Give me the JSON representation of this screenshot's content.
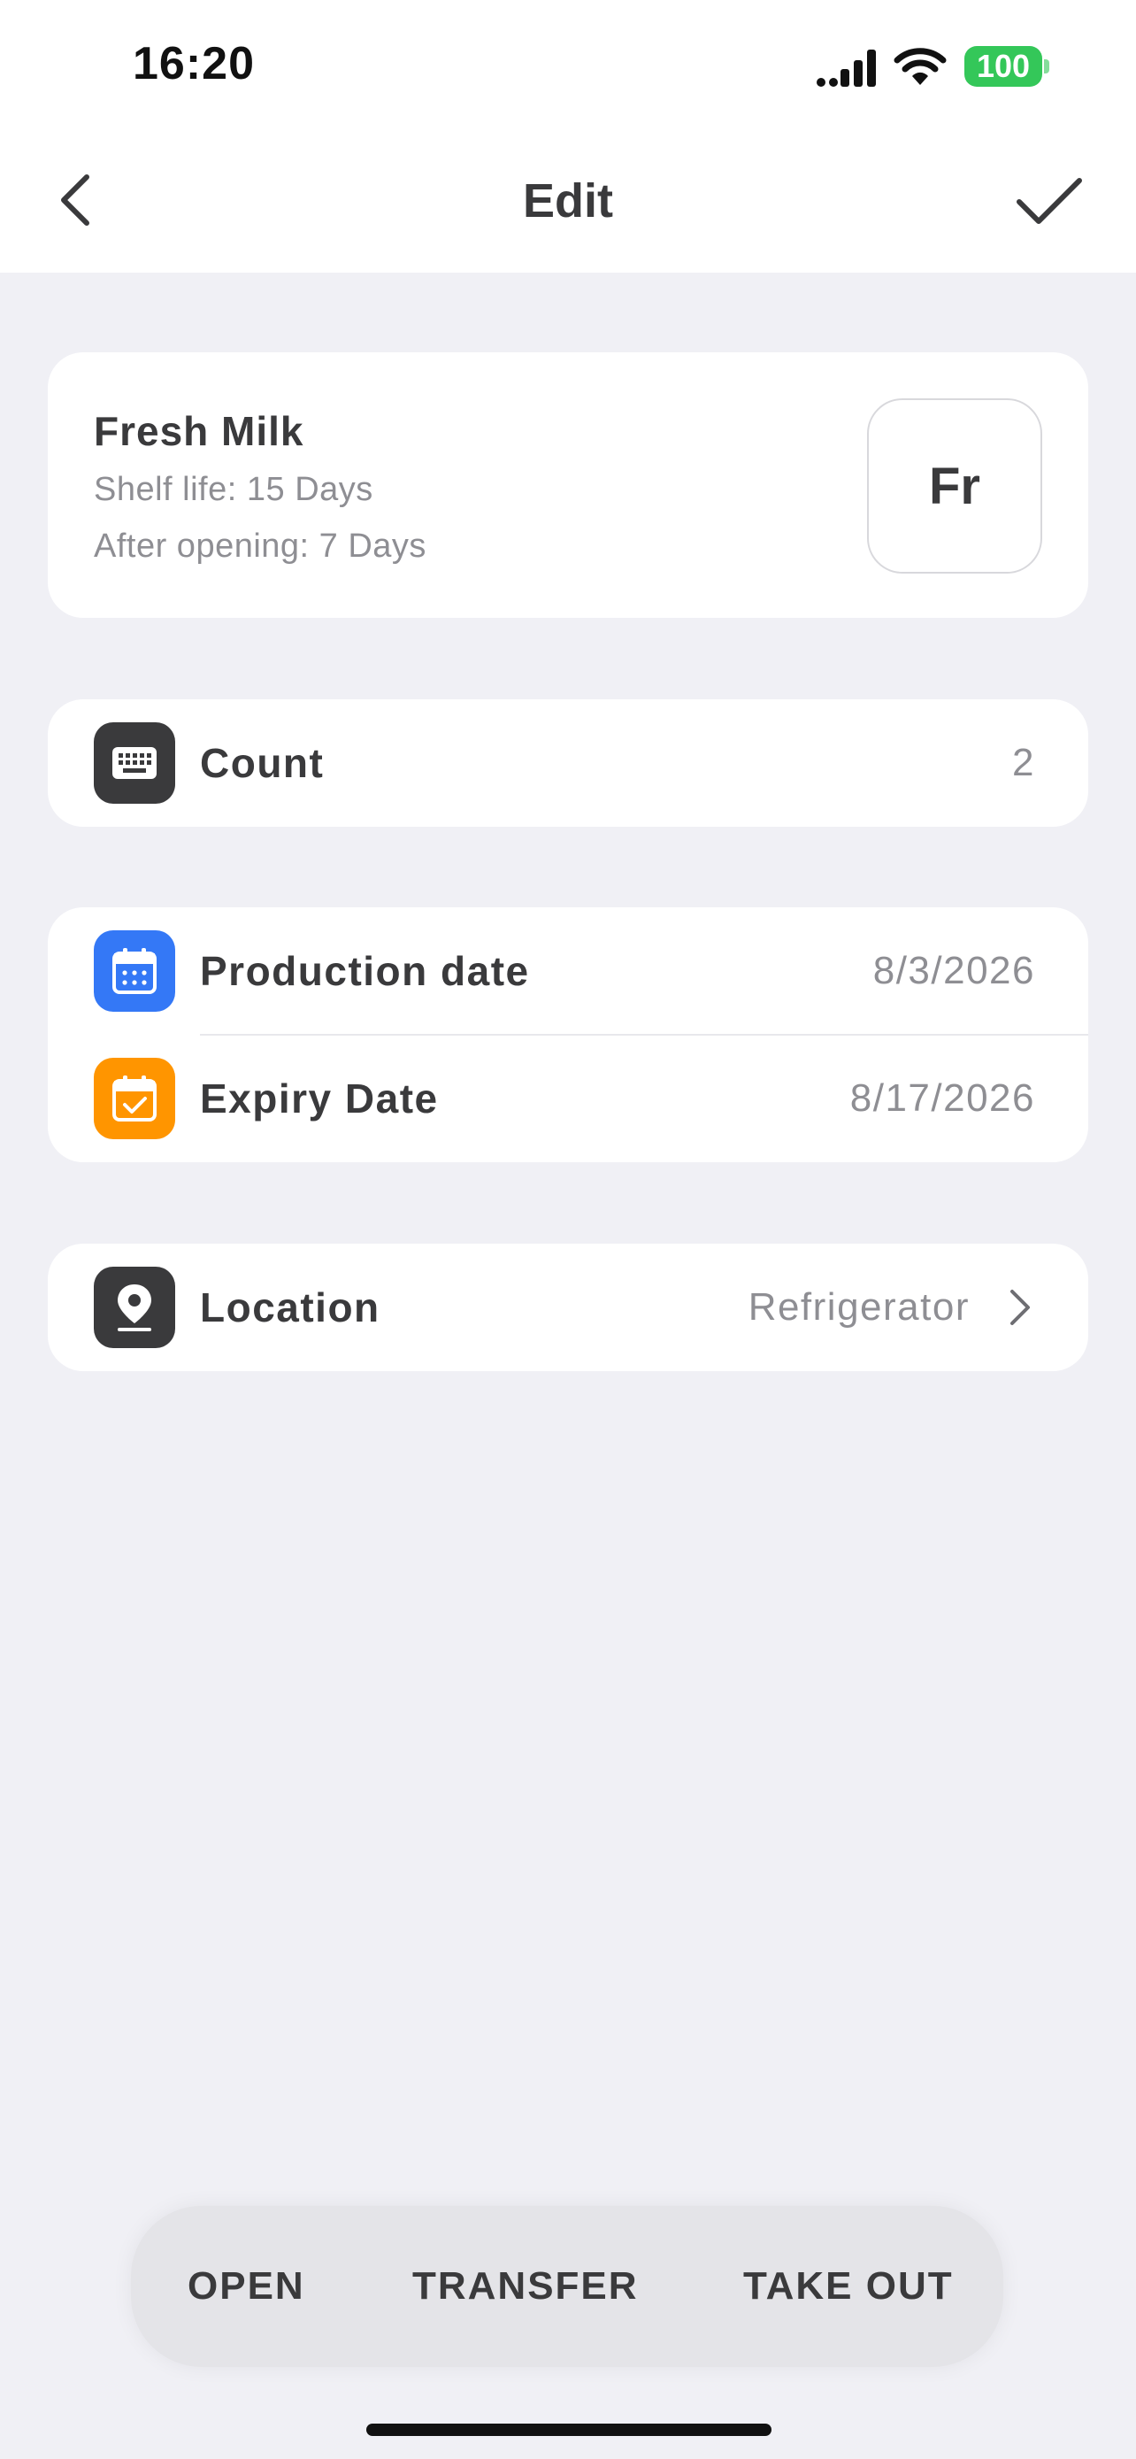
{
  "status_bar": {
    "time": "16:20",
    "battery": "100"
  },
  "nav": {
    "title": "Edit",
    "back_icon": "chevron-left-icon",
    "done_icon": "checkmark-icon"
  },
  "product": {
    "name": "Fresh Milk",
    "shelf_life": "Shelf life: 15 Days",
    "after_opening": "After opening: 7 Days",
    "thumbnail_text": "Fr"
  },
  "count": {
    "label": "Count",
    "value": "2",
    "icon": "keyboard-icon"
  },
  "dates": {
    "production": {
      "label": "Production date",
      "value": "8/3/2026",
      "icon": "calendar-icon",
      "color": "#3478f6"
    },
    "expiry": {
      "label": "Expiry Date",
      "value": "8/17/2026",
      "icon": "calendar-check-icon",
      "color": "#ff9500"
    }
  },
  "location": {
    "label": "Location",
    "value": "Refrigerator",
    "icon": "location-pin-icon"
  },
  "actions": {
    "open": "OPEN",
    "transfer": "TRANSFER",
    "take_out": "TAKE OUT"
  },
  "colors": {
    "background": "#f0f0f5",
    "card": "#ffffff",
    "dark_icon": "#3a3a3c",
    "battery": "#34c759"
  }
}
